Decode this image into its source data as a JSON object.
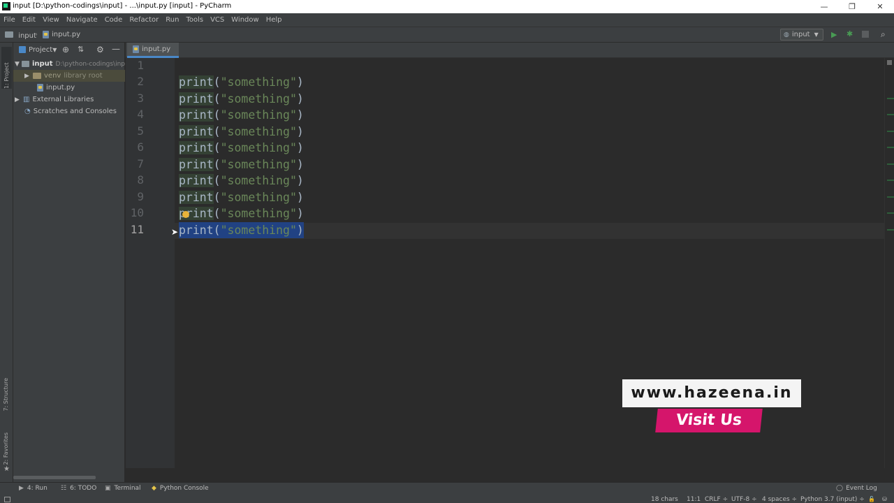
{
  "window": {
    "title": "input [D:\\python-codings\\input] - ...\\input.py [input] - PyCharm",
    "controls": [
      "—",
      "❐",
      "✕"
    ]
  },
  "menu": [
    "File",
    "Edit",
    "View",
    "Navigate",
    "Code",
    "Refactor",
    "Run",
    "Tools",
    "VCS",
    "Window",
    "Help"
  ],
  "nav": {
    "crumb_project": "input",
    "crumb_file": "input.py",
    "run_config": "input"
  },
  "sidebar": {
    "project_tab": "1: Project",
    "structure_tab": "7: Structure",
    "favorites_tab": "2: Favorites"
  },
  "project_panel": {
    "header": "Project",
    "tree": {
      "root_name": "input",
      "root_path": "D:\\python-codings\\inp",
      "venv_name": "venv",
      "venv_note": "library root",
      "file": "input.py",
      "external": "External Libraries",
      "scratches": "Scratches and Consoles"
    }
  },
  "editor": {
    "tab_label": "input.py",
    "line_numbers": [
      "1",
      "2",
      "3",
      "4",
      "5",
      "6",
      "7",
      "8",
      "9",
      "10",
      "11"
    ],
    "code": {
      "fn": "print",
      "open": "(",
      "str": "\"something\"",
      "close": ")"
    }
  },
  "watermark": {
    "url": "www.hazeena.in",
    "cta": "Visit Us"
  },
  "bottom_tools": {
    "run": "4: Run",
    "todo": "6: TODO",
    "terminal": "Terminal",
    "python_console": "Python Console",
    "event_log": "Event Log"
  },
  "status": {
    "chars": "18 chars",
    "position": "11:1",
    "line_sep": "CRLF ÷",
    "encoding": "UTF-8 ÷",
    "indent": "4 spaces ÷",
    "interpreter": "Python 3.7 (input) ÷"
  },
  "colors": {
    "accent": "#4a88c7",
    "selection": "#214283",
    "string": "#6a8759",
    "run_green": "#499c54",
    "watermark_pink": "#d5156b"
  }
}
